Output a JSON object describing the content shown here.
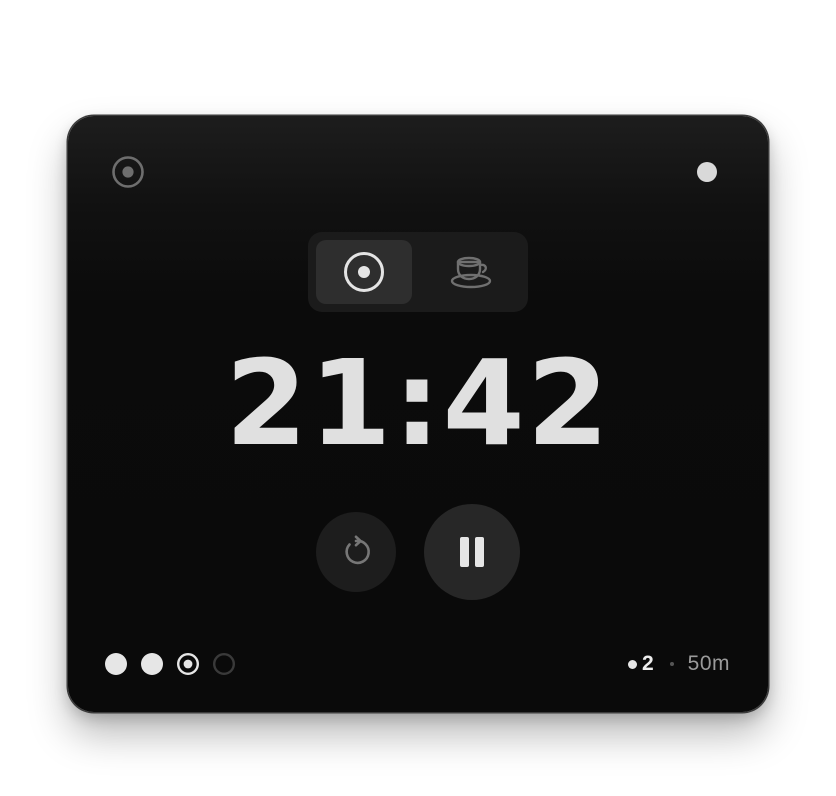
{
  "colors": {
    "window_bg": "#0a0a0a",
    "accent_light": "#e0e0e0",
    "active_segment": "#2e2e2e",
    "icon_muted": "#777777"
  },
  "header": {
    "left_icon": "focus-target-icon",
    "right_icon": "status-dot-icon"
  },
  "mode_switch": {
    "options": [
      {
        "id": "focus",
        "icon": "focus-target-icon",
        "selected": true
      },
      {
        "id": "break",
        "icon": "coffee-cup-icon",
        "selected": false
      }
    ]
  },
  "timer": {
    "display": "21:42"
  },
  "controls": {
    "reset_icon": "reset-icon",
    "play_pause_icon": "pause-icon",
    "state": "running"
  },
  "sessions": {
    "items": [
      {
        "state": "completed"
      },
      {
        "state": "completed"
      },
      {
        "state": "current"
      },
      {
        "state": "pending"
      }
    ]
  },
  "stats": {
    "count": "2",
    "duration": "50m"
  }
}
